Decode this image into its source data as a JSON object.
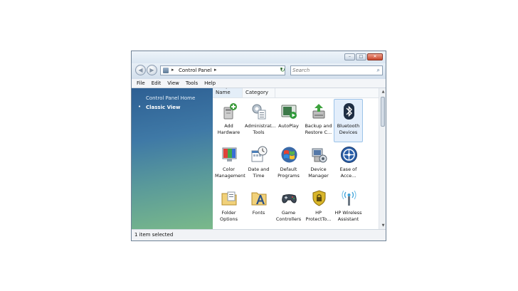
{
  "window": {
    "caption_buttons": [
      "–",
      "□",
      "✕"
    ]
  },
  "nav": {
    "back_glyph": "◀",
    "forward_glyph": "▶",
    "breadcrumb_separator": "▸",
    "address_crumb": "Control Panel",
    "address_dropdown_glyph": "▾",
    "refresh_glyph": "↻",
    "search_placeholder": "Search",
    "search_icon_glyph": "⌕"
  },
  "menu": [
    "File",
    "Edit",
    "View",
    "Tools",
    "Help"
  ],
  "sidebar": {
    "home_link": "Control Panel Home",
    "classic_view": "Classic View",
    "bullet": "•"
  },
  "columns": {
    "name": "Name",
    "category": "Category",
    "sort_glyph": "˄"
  },
  "items": [
    {
      "label": "Add\nHardware",
      "icon": "add-hardware-icon"
    },
    {
      "label": "Administrat...\nTools",
      "icon": "administrative-tools-icon"
    },
    {
      "label": "AutoPlay",
      "icon": "autoplay-icon"
    },
    {
      "label": "Backup and\nRestore C...",
      "icon": "backup-restore-icon"
    },
    {
      "label": "Bluetooth\nDevices",
      "icon": "bluetooth-icon",
      "selected": true
    },
    {
      "label": "Color\nManagement",
      "icon": "color-management-icon"
    },
    {
      "label": "Date and\nTime",
      "icon": "date-time-icon"
    },
    {
      "label": "Default\nPrograms",
      "icon": "default-programs-icon"
    },
    {
      "label": "Device\nManager",
      "icon": "device-manager-icon"
    },
    {
      "label": "Ease of\nAcce...",
      "icon": "ease-of-access-icon"
    },
    {
      "label": "Folder\nOptions",
      "icon": "folder-options-icon"
    },
    {
      "label": "Fonts",
      "icon": "fonts-icon"
    },
    {
      "label": "Game\nControllers",
      "icon": "game-controllers-icon"
    },
    {
      "label": "HP\nProtectTo...",
      "icon": "hp-protecttools-icon"
    },
    {
      "label": "HP Wireless\nAssistant",
      "icon": "hp-wireless-icon"
    }
  ],
  "scrollbar": {
    "up_glyph": "▲",
    "down_glyph": "▼"
  },
  "status": {
    "text": "1 item selected"
  },
  "colors": {
    "sidebar_top": "#2d5f93",
    "sidebar_bottom": "#7ab98a",
    "selection": "#e3eefb",
    "close_button": "#c8442a"
  }
}
